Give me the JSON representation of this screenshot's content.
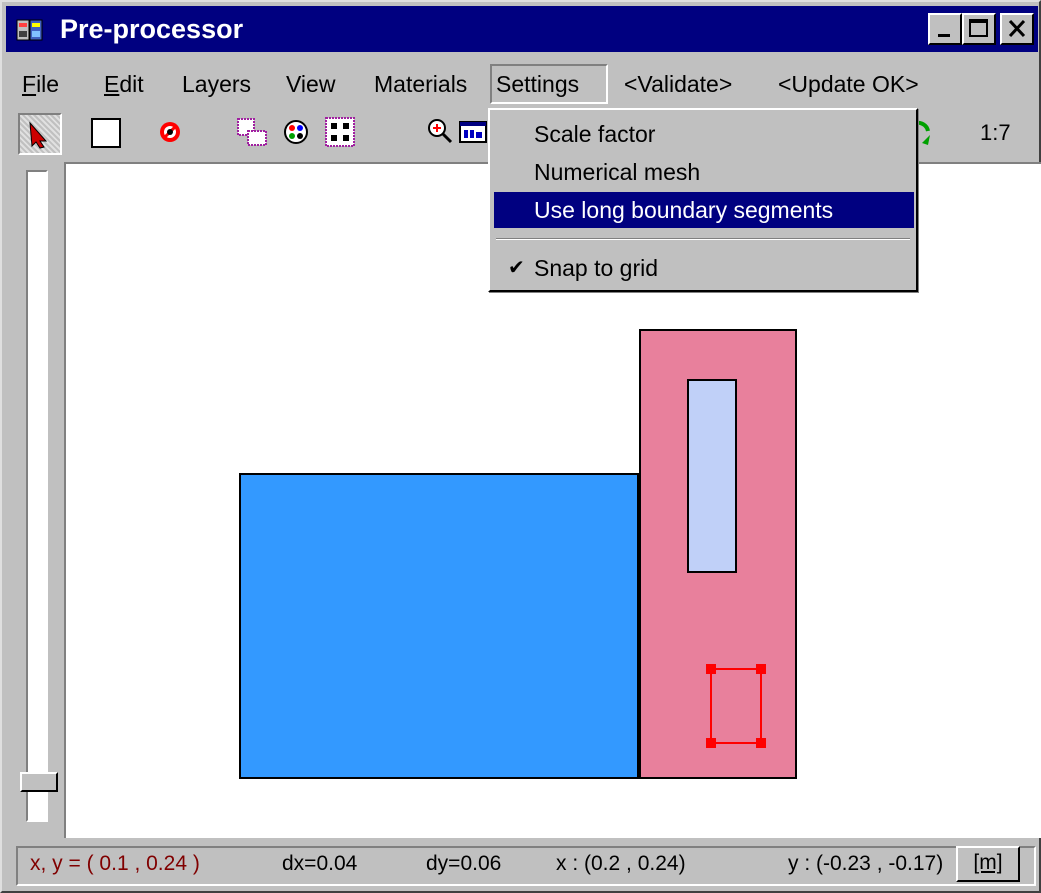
{
  "window": {
    "title": "Pre-processor",
    "controls": [
      "minimize-icon",
      "maximize-icon",
      "close-icon"
    ]
  },
  "menubar": {
    "items": [
      {
        "label": "File",
        "mnemonic": "F",
        "rest": "ile"
      },
      {
        "label": "Edit",
        "mnemonic": "E",
        "rest": "dit"
      },
      {
        "label": "Layers"
      },
      {
        "label": "View"
      },
      {
        "label": "Materials"
      },
      {
        "label": "Settings",
        "open": true
      },
      {
        "label": "<Validate>"
      },
      {
        "label": "<Update OK>"
      }
    ]
  },
  "toolbar": {
    "tools": [
      "select-arrow-icon",
      "rectangle-icon",
      "no-entry-icon",
      "layers-icon",
      "palette-icon",
      "grid-points-icon",
      "zoom-in-icon",
      "window-icon",
      "refresh-icon"
    ],
    "scale": "1:7"
  },
  "settings_menu": {
    "items": [
      {
        "label": "Scale factor",
        "checked": false,
        "highlighted": false
      },
      {
        "label": "Numerical mesh",
        "checked": false,
        "highlighted": false
      },
      {
        "label": "Use long boundary segments",
        "checked": false,
        "highlighted": true
      },
      {
        "label": "Snap to grid",
        "checked": true,
        "highlighted": false
      }
    ]
  },
  "drawing": {
    "colors": {
      "blue_region": "#3399ff",
      "pink_region": "#e8809c",
      "light_region": "#c0d0f8",
      "selection": "#ff0000"
    }
  },
  "status": {
    "cursor": "x, y = ( 0.1 ,  0.24 )",
    "dx": "dx=0.04",
    "dy": "dy=0.06",
    "x_range": "x :  (0.2 ,  0.24)",
    "y_range": "y :  (-0.23 ,  -0.17)",
    "unit": "[m]"
  }
}
